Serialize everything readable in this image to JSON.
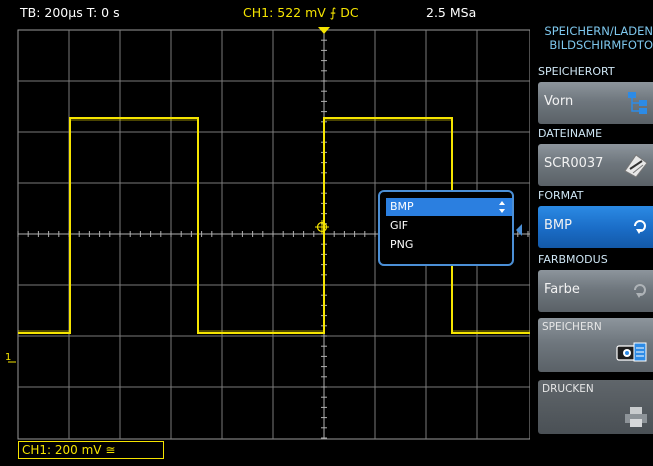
{
  "status_bar": {
    "timebase": "TB: 200µs   T: 0 s",
    "channel": "CH1: 522 mV ⨍ DC",
    "sample_rate": "2.5 MSa"
  },
  "menu": {
    "title_line1": "SPEICHERN/LADEN",
    "title_line2": "BILDSCHIRMFOTO",
    "sections": [
      {
        "label": "SPEICHERORT",
        "value": "Vorn",
        "icon": "folder-tree-icon"
      },
      {
        "label": "DATEINAME",
        "value": "SCR0037",
        "icon": "edit-pen-icon"
      },
      {
        "label": "FORMAT",
        "value": "BMP",
        "icon": "cycle-arrow-icon"
      },
      {
        "label": "FARBMODUS",
        "value": "Farbe",
        "icon": "cycle-arrow-icon"
      },
      {
        "label": "SPEICHERN",
        "icon": "camera-save-icon"
      },
      {
        "label": "DRUCKEN",
        "icon": "printer-icon"
      }
    ]
  },
  "format_popup": {
    "options": [
      "BMP",
      "GIF",
      "PNG"
    ],
    "selected": "BMP"
  },
  "channel_box": "CH1: 200 mV ≅",
  "ground_marker": "1",
  "colors": {
    "trace": "#f5e400",
    "accent": "#2b7fe0",
    "menu_title": "#7ec8ee"
  }
}
